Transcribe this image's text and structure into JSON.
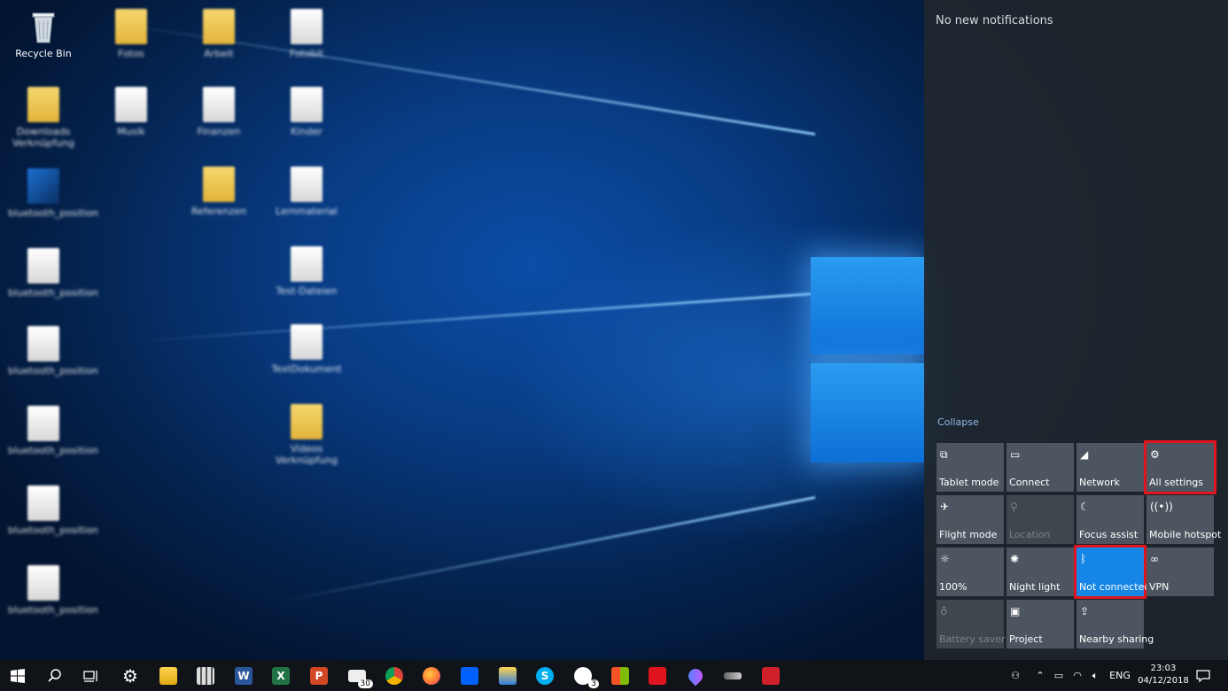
{
  "desktop": {
    "recycle_bin_label": "Recycle Bin",
    "blurred_labels": [
      "Fotos",
      "Arbeit",
      "Fotobit",
      "Downloads Verknüpfung",
      "Musik",
      "Finanzen",
      "Kinder",
      "bluetooth_position",
      "Referenzen",
      "Lernmaterial",
      "bluetooth_position",
      "Test-Dateien",
      "bluetooth_position",
      "TextDokument",
      "bluetooth_position",
      "Videos Verknüpfung",
      "bluetooth_position",
      "bluetooth_position"
    ]
  },
  "action_center": {
    "no_notifications": "No new notifications",
    "collapse": "Collapse",
    "tiles": [
      {
        "label": "Tablet mode",
        "icon": "tablet-mode-icon",
        "glyph": "⧉",
        "state": "normal"
      },
      {
        "label": "Connect",
        "icon": "connect-icon",
        "glyph": "▭",
        "state": "normal"
      },
      {
        "label": "Network",
        "icon": "network-icon",
        "glyph": "◢",
        "state": "normal"
      },
      {
        "label": "All settings",
        "icon": "gear-icon",
        "glyph": "⚙",
        "state": "highlight"
      },
      {
        "label": "Flight mode",
        "icon": "airplane-icon",
        "glyph": "✈",
        "state": "normal"
      },
      {
        "label": "Location",
        "icon": "location-icon",
        "glyph": "⚲",
        "state": "disabled"
      },
      {
        "label": "Focus assist",
        "icon": "moon-icon",
        "glyph": "☾",
        "state": "normal"
      },
      {
        "label": "Mobile hotspot",
        "icon": "hotspot-icon",
        "glyph": "((•))",
        "state": "normal"
      },
      {
        "label": "100%",
        "icon": "brightness-icon",
        "glyph": "☼",
        "state": "normal"
      },
      {
        "label": "Night light",
        "icon": "night-light-icon",
        "glyph": "✺",
        "state": "normal"
      },
      {
        "label": "Not connected",
        "icon": "bluetooth-icon",
        "glyph": "ᛒ",
        "state": "active highlight"
      },
      {
        "label": "VPN",
        "icon": "vpn-icon",
        "glyph": "∞",
        "state": "normal"
      },
      {
        "label": "Battery saver",
        "icon": "battery-saver-icon",
        "glyph": "♁",
        "state": "disabled"
      },
      {
        "label": "Project",
        "icon": "project-icon",
        "glyph": "▣",
        "state": "normal"
      },
      {
        "label": "Nearby sharing",
        "icon": "share-icon",
        "glyph": "⇪",
        "state": "normal"
      }
    ]
  },
  "taskbar": {
    "mail_badge": "30",
    "xbox_badge": "3",
    "language": "ENG",
    "time": "23:03",
    "date": "04/12/2018"
  },
  "colors": {
    "accent": "#1585e6",
    "highlight": "#e0141e",
    "tile": "#4d5660"
  }
}
